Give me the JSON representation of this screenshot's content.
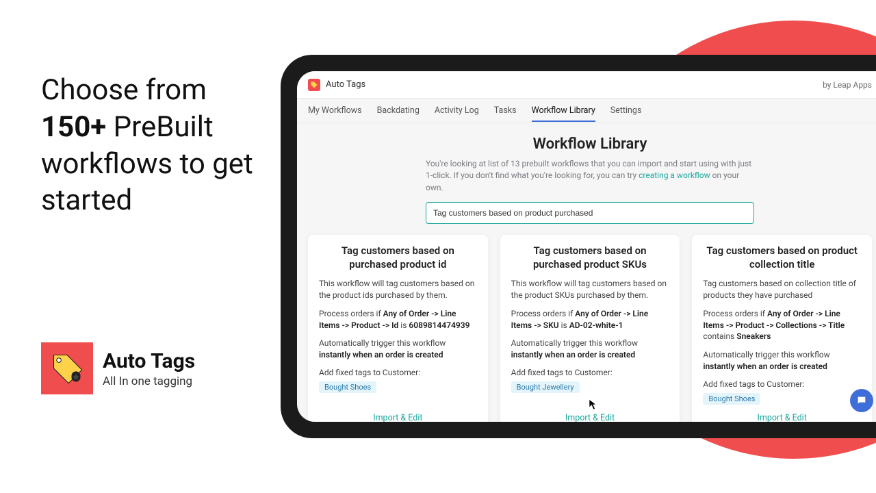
{
  "marketing": {
    "line1": "Choose from",
    "bold": "150+",
    "line2_rest": " PreBuilt",
    "line3": "workflows  to get",
    "line4": "started"
  },
  "brand": {
    "name": "Auto Tags",
    "sub": "All In one tagging"
  },
  "app": {
    "title": "Auto Tags",
    "vendor": "by Leap Apps"
  },
  "tabs": [
    {
      "label": "My Workflows",
      "active": false
    },
    {
      "label": "Backdating",
      "active": false
    },
    {
      "label": "Activity Log",
      "active": false
    },
    {
      "label": "Tasks",
      "active": false
    },
    {
      "label": "Workflow Library",
      "active": true
    },
    {
      "label": "Settings",
      "active": false
    }
  ],
  "page": {
    "title": "Workflow Library",
    "blurb_pre": "You're looking at list of 13 prebuilt workflows that you can import and start using with just 1-click. If you don't find what you're looking for, you can try ",
    "blurb_link": "creating a workflow",
    "blurb_post": " on your own.",
    "search_value": "Tag customers based on product purchased"
  },
  "cards": [
    {
      "title": "Tag customers based on purchased product id",
      "desc": "This workflow will tag customers based on the product ids purchased by them.",
      "rule_pre": "Process orders if ",
      "rule_bold": "Any of Order -> Line Items -> Product -> Id",
      "rule_mid": " is ",
      "rule_val": "6089814474939",
      "trigger_pre": "Automatically trigger this workflow ",
      "trigger_bold": "instantly when an order is created",
      "tag_label": "Add fixed tags to Customer:",
      "tag": "Bought Shoes",
      "cta": "Import & Edit"
    },
    {
      "title": "Tag customers based on purchased product SKUs",
      "desc": "This workflow will tag customers based on the product SKUs purchased by them.",
      "rule_pre": "Process orders if ",
      "rule_bold": "Any of Order -> Line Items -> SKU",
      "rule_mid": " is ",
      "rule_val": "AD-02-white-1",
      "trigger_pre": "Automatically trigger this workflow ",
      "trigger_bold": "instantly when an order is created",
      "tag_label": "Add fixed tags to Customer:",
      "tag": "Bought Jewellery",
      "cta": "Import & Edit"
    },
    {
      "title": "Tag customers based on product collection title",
      "desc": "Tag customers based on collection title of products they have purchased",
      "rule_pre": "Process orders if ",
      "rule_bold": "Any of Order -> Line Items -> Product -> Collections -> Title",
      "rule_mid": " contains ",
      "rule_val": "Sneakers",
      "trigger_pre": "Automatically trigger this workflow ",
      "trigger_bold": "instantly when an order is created",
      "tag_label": "Add fixed tags to Customer:",
      "tag": "Bought Shoes",
      "cta": "Import & Edit"
    }
  ]
}
